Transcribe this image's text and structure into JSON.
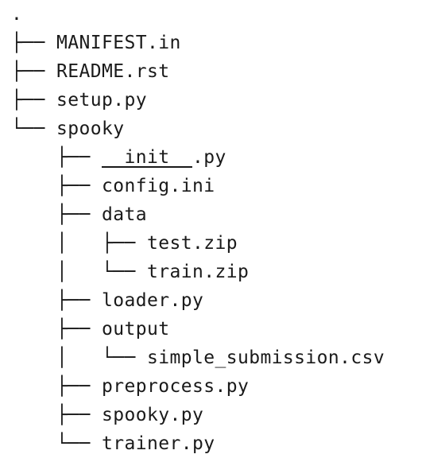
{
  "tree": {
    "root": ".",
    "lines": [
      {
        "prefix": "├── ",
        "name": "MANIFEST.in"
      },
      {
        "prefix": "├── ",
        "name": "README.rst"
      },
      {
        "prefix": "├── ",
        "name": "setup.py"
      },
      {
        "prefix": "└── ",
        "name": "spooky"
      },
      {
        "prefix": "    ├── ",
        "name_underlined": "__init__",
        "name_suffix": ".py"
      },
      {
        "prefix": "    ├── ",
        "name": "config.ini"
      },
      {
        "prefix": "    ├── ",
        "name": "data"
      },
      {
        "prefix": "    │   ├── ",
        "name": "test.zip"
      },
      {
        "prefix": "    │   └── ",
        "name": "train.zip"
      },
      {
        "prefix": "    ├── ",
        "name": "loader.py"
      },
      {
        "prefix": "    ├── ",
        "name": "output"
      },
      {
        "prefix": "    │   └── ",
        "name": "simple_submission.csv"
      },
      {
        "prefix": "    ├── ",
        "name": "preprocess.py"
      },
      {
        "prefix": "    ├── ",
        "name": "spooky.py"
      },
      {
        "prefix": "    └── ",
        "name": "trainer.py"
      }
    ]
  }
}
